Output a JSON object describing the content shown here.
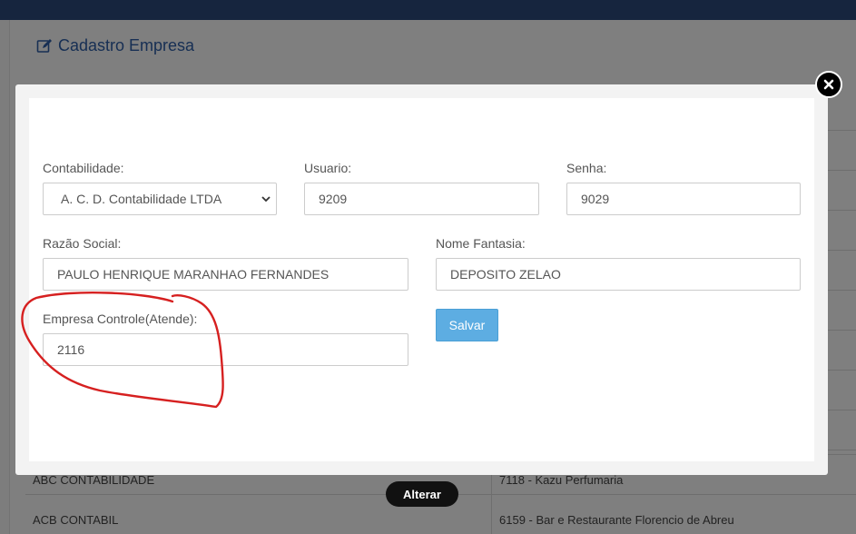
{
  "page": {
    "title": "Cadastro Empresa",
    "table_rows": [
      {
        "col1": "ABC CONTABILIDADE",
        "col2": "7118 - Kazu Perfumaria"
      },
      {
        "col1": "ACB CONTABIL",
        "col2": "6159 - Bar e Restaurante Florencio de Abreu"
      }
    ],
    "alterar_label": "Alterar"
  },
  "modal": {
    "contabilidade": {
      "label": "Contabilidade:",
      "value": "A. C. D. Contabilidade LTDA"
    },
    "usuario": {
      "label": "Usuario:",
      "value": "9209"
    },
    "senha": {
      "label": "Senha:",
      "value": "9029"
    },
    "razao_social": {
      "label": "Razão Social:",
      "value": "PAULO HENRIQUE MARANHAO FERNANDES"
    },
    "nome_fantasia": {
      "label": "Nome Fantasia:",
      "value": "DEPOSITO ZELAO"
    },
    "empresa_controle": {
      "label": "Empresa Controle(Atende):",
      "value": "2116"
    },
    "salvar_label": "Salvar"
  },
  "colors": {
    "topbar": "#2c4a7c",
    "title": "#2f5fa8",
    "salvar": "#5dade2",
    "annotation": "#d62020"
  },
  "icons": [
    "edit-icon",
    "close-icon",
    "chevron-down-icon"
  ]
}
